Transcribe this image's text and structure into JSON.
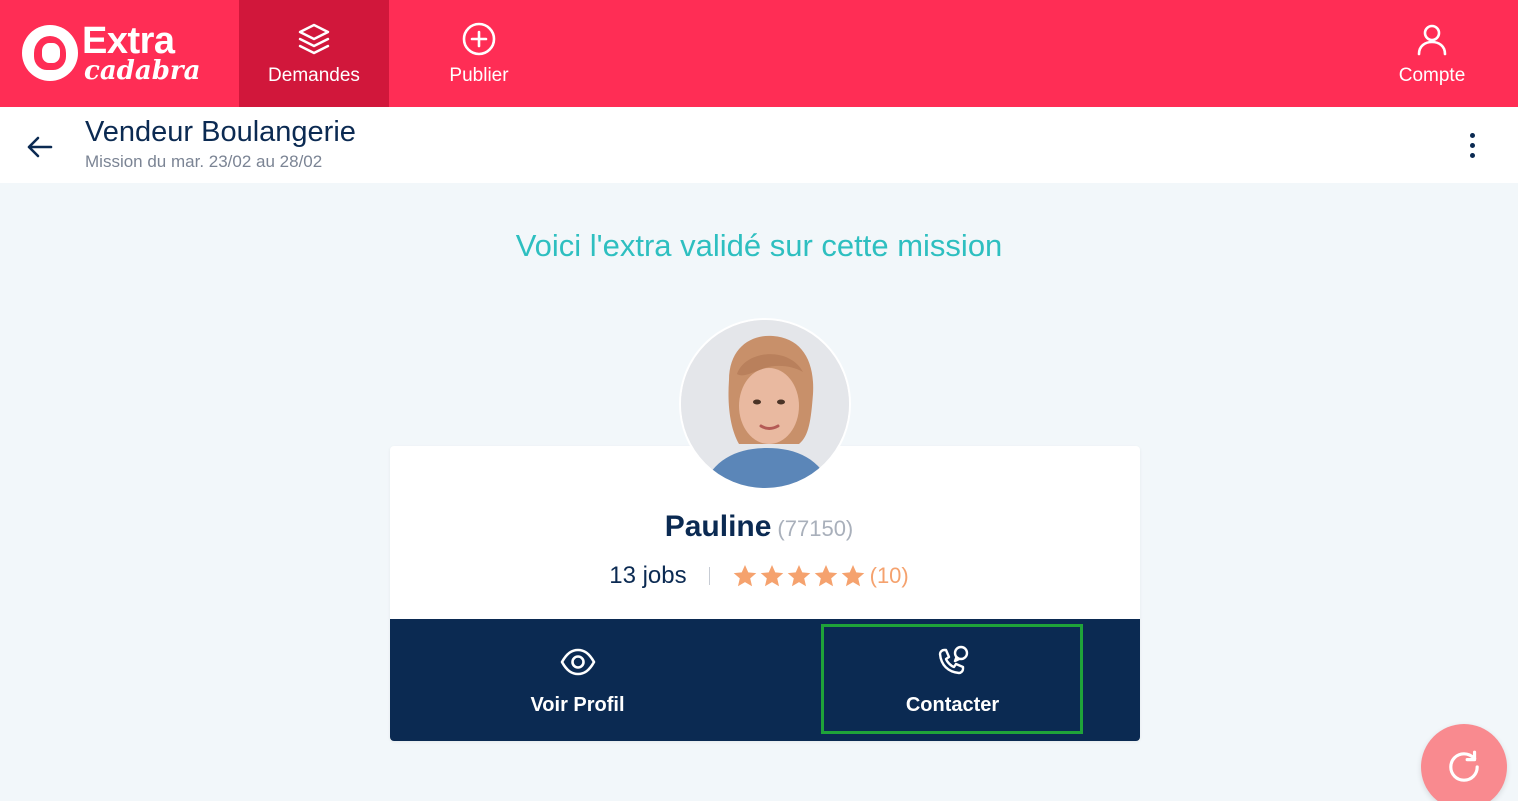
{
  "brand": {
    "word1": "Extra",
    "word2": "cadabra"
  },
  "nav": {
    "demandes": "Demandes",
    "publier": "Publier",
    "compte": "Compte"
  },
  "mission": {
    "title": "Vendeur Boulangerie",
    "subtitle": "Mission du mar. 23/02 au 28/02"
  },
  "headline": "Voici l'extra validé sur cette mission",
  "extra": {
    "name": "Pauline",
    "zip": "(77150)",
    "jobs": "13 jobs",
    "rating_stars": 5,
    "rating_count": "(10)"
  },
  "actions": {
    "view_profile": "Voir Profil",
    "contact": "Contacter"
  },
  "colors": {
    "brand": "#ff2d55",
    "brand_active": "#d1173b",
    "navy": "#0b2a52",
    "teal": "#2ebfc0",
    "star": "#f5a26e",
    "highlight": "#1fa339"
  },
  "icons": {
    "demandes": "layers-icon",
    "publier": "plus-circle-icon",
    "compte": "user-icon",
    "back": "arrow-left-icon",
    "more": "kebab-menu-icon",
    "view": "eye-icon",
    "contact": "phone-chat-icon",
    "refresh": "refresh-icon"
  }
}
